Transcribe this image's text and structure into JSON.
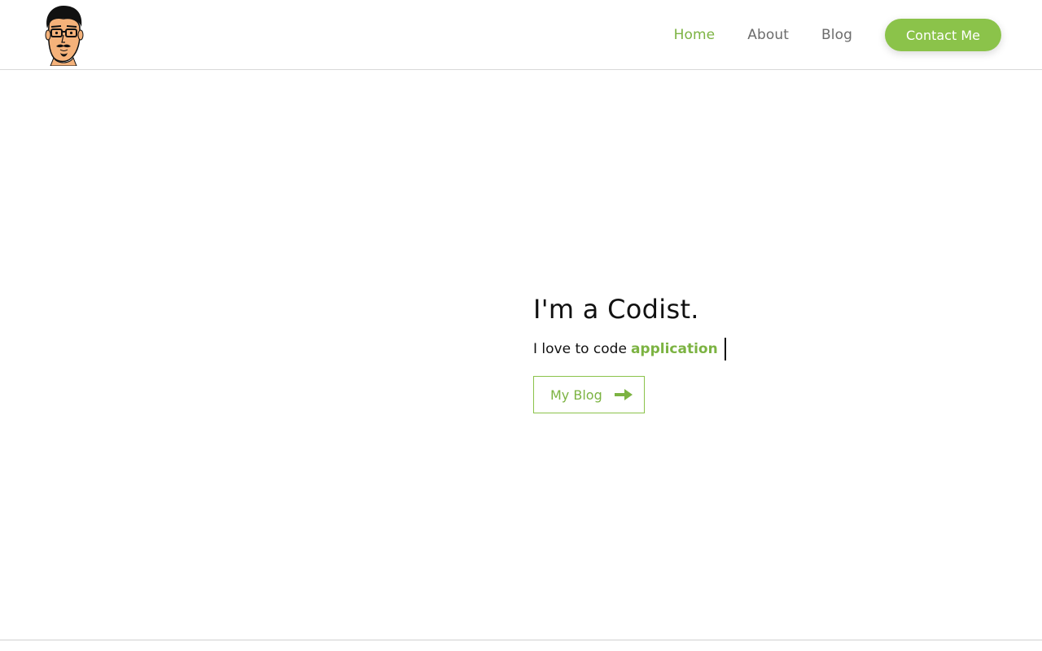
{
  "header": {
    "logo_alt": "Codist avatar",
    "nav": [
      {
        "label": "Home",
        "active": true
      },
      {
        "label": "About",
        "active": false
      },
      {
        "label": "Blog",
        "active": false
      }
    ],
    "contact_label": "Contact Me"
  },
  "hero": {
    "title": "I'm a Codist.",
    "subtitle_prefix": "I love to code",
    "subtitle_word": "application",
    "blog_button_label": "My Blog"
  },
  "colors": {
    "accent": "#8bc34a",
    "accent_text": "#7cb342",
    "nav_text": "#6b6b6b",
    "text": "#111111"
  },
  "icons": {
    "logo": "cartoon-face-icon",
    "blog_arrow": "arrow-right-icon"
  }
}
